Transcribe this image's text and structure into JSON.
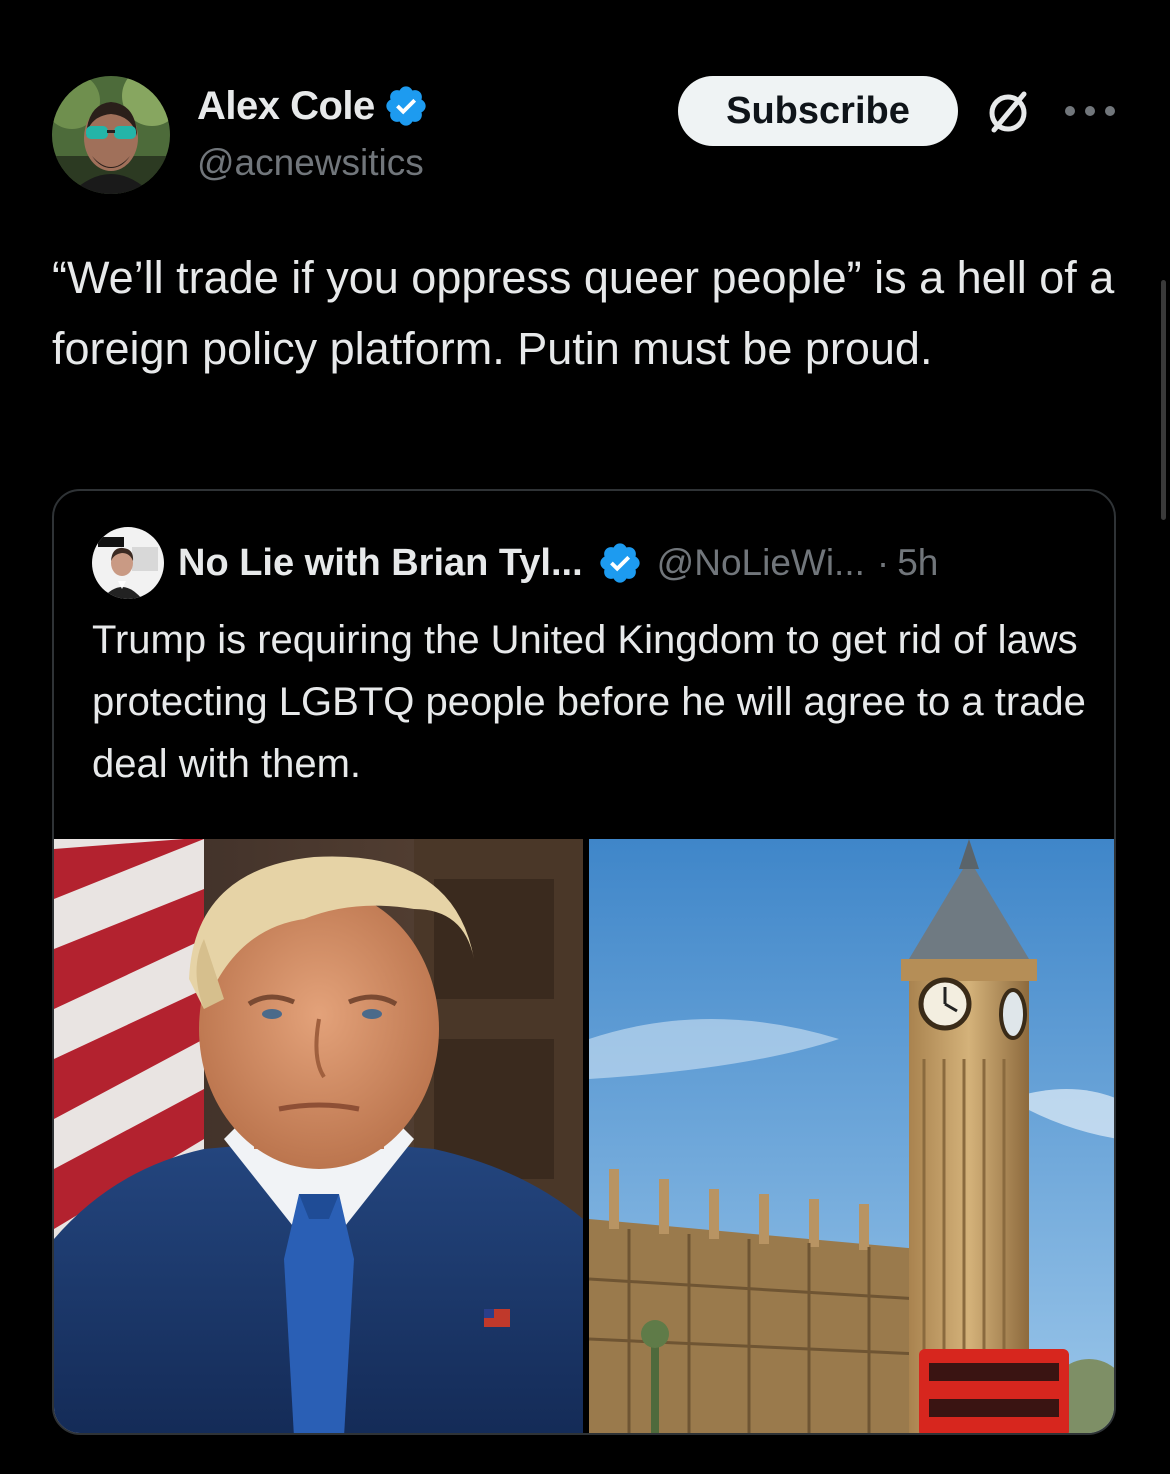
{
  "post": {
    "author": {
      "name": "Alex Cole",
      "handle": "@acnewsitics",
      "verified": true,
      "avatar_icon": "user-avatar-sunglasses"
    },
    "subscribe_label": "Subscribe",
    "text": "“We’ll trade if you oppress queer people” is a hell of a foreign policy platform. Putin must be proud."
  },
  "quoted_post": {
    "author": {
      "name": "No Lie with Brian Tyl...",
      "handle": "@NoLieWi...",
      "verified": true,
      "avatar_icon": "no-lie-avatar"
    },
    "separator": "·",
    "time": "5h",
    "text": "Trump is requiring the United Kingdom to get rid of laws protecting LGBTQ people before he will agree to a trade deal with them.",
    "media": [
      {
        "kind": "photo",
        "subject": "portrait-in-blue-suit"
      },
      {
        "kind": "photo",
        "subject": "big-ben-clock-tower"
      }
    ]
  },
  "colors": {
    "background": "#000000",
    "text_primary": "#e7e9ea",
    "text_secondary": "#71767b",
    "border": "#2f3336",
    "verified_blue": "#1d9bf0",
    "button_bg": "#eff3f4"
  }
}
